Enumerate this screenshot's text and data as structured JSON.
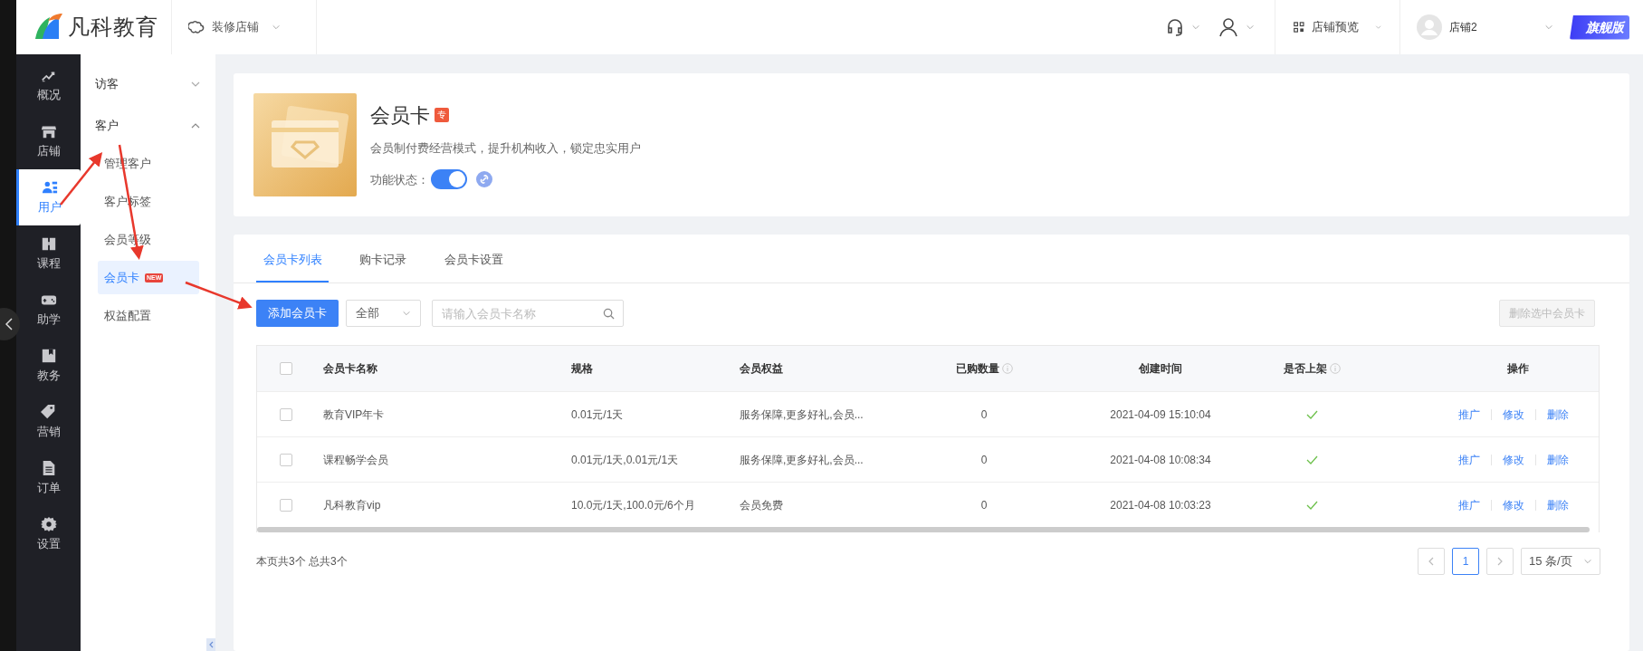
{
  "topbar": {
    "logo_text": "凡科教育",
    "decorate": "装修店铺",
    "preview": "店铺预览",
    "shop_name": "店铺2",
    "edition_badge": "旗舰版"
  },
  "nav": [
    {
      "label": "概况",
      "selected": false
    },
    {
      "label": "店铺",
      "selected": false
    },
    {
      "label": "用户",
      "selected": true
    },
    {
      "label": "课程",
      "selected": false
    },
    {
      "label": "助学",
      "selected": false
    },
    {
      "label": "教务",
      "selected": false
    },
    {
      "label": "营销",
      "selected": false
    },
    {
      "label": "订单",
      "selected": false
    },
    {
      "label": "设置",
      "selected": false
    }
  ],
  "subnav": [
    {
      "label": "访客",
      "expanded": false
    },
    {
      "label": "客户",
      "expanded": true,
      "children": [
        {
          "label": "管理客户",
          "selected": false
        },
        {
          "label": "客户标签",
          "selected": false
        },
        {
          "label": "会员等级",
          "selected": false
        },
        {
          "label": "会员卡",
          "selected": true,
          "badge": "NEW"
        },
        {
          "label": "权益配置",
          "selected": false
        }
      ]
    }
  ],
  "feature": {
    "title": "会员卡",
    "title_badge": "专",
    "description": "会员制付费经营模式，提升机构收入，锁定忠实用户",
    "status_label": "功能状态：",
    "on": true
  },
  "tabs": [
    {
      "label": "会员卡列表",
      "selected": true
    },
    {
      "label": "购卡记录",
      "selected": false
    },
    {
      "label": "会员卡设置",
      "selected": false
    }
  ],
  "toolbar": {
    "add_button": "添加会员卡",
    "filter": "全部",
    "search": {
      "placeholder": "请输入会员卡名称"
    },
    "delete_button": {
      "label": "删除选中会员卡",
      "disabled": true
    }
  },
  "table": {
    "header_checked": false,
    "columns": [
      {
        "label": "会员卡名称",
        "info": false
      },
      {
        "label": "规格",
        "info": false
      },
      {
        "label": "会员权益",
        "info": false
      },
      {
        "label": "已购数量",
        "info": true
      },
      {
        "label": "创建时间",
        "info": false
      },
      {
        "label": "是否上架",
        "info": true
      },
      {
        "label": "操作",
        "info": false
      }
    ],
    "rows": [
      {
        "checked": false,
        "name": "教育VIP年卡",
        "spec": "0.01元/1天",
        "benefits": "服务保障,更多好礼,会员...",
        "purchased": "0",
        "created": "2021-04-09 15:10:04",
        "listed": true,
        "actions": [
          "推广",
          "修改",
          "删除"
        ]
      },
      {
        "checked": false,
        "name": "课程畅学会员",
        "spec": "0.01元/1天,0.01元/1天",
        "benefits": "服务保障,更多好礼,会员...",
        "purchased": "0",
        "created": "2021-04-08 10:08:34",
        "listed": true,
        "actions": [
          "推广",
          "修改",
          "删除"
        ]
      },
      {
        "checked": false,
        "name": "凡科教育vip",
        "spec": "10.0元/1天,100.0元/6个月",
        "benefits": "会员免费",
        "purchased": "0",
        "created": "2021-04-08 10:03:23",
        "listed": true,
        "actions": [
          "推广",
          "修改",
          "删除"
        ]
      }
    ]
  },
  "footer": {
    "summary": "本页共3个 总共3个",
    "pages": [
      {
        "label": "1",
        "selected": true
      }
    ],
    "page_size": "15 条/页"
  }
}
